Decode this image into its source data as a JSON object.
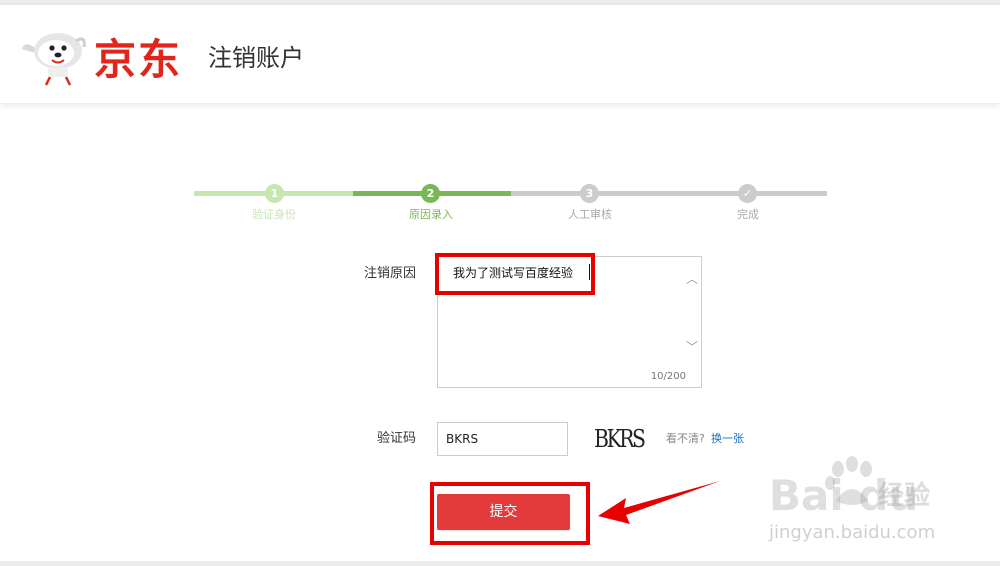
{
  "header": {
    "logo_text": "京东",
    "page_title": "注销账户"
  },
  "steps": [
    {
      "number": "1",
      "label": "验证身份",
      "state": "done"
    },
    {
      "number": "2",
      "label": "原因录入",
      "state": "current"
    },
    {
      "number": "3",
      "label": "人工审核",
      "state": "pending"
    },
    {
      "number": "✓",
      "label": "完成",
      "state": "pending"
    }
  ],
  "form": {
    "reason_label": "注销原因",
    "reason_value": "我为了测试写百度经验",
    "counter": "10/200",
    "code_label": "验证码",
    "code_value": "BKRS",
    "captcha_text": "BKRS",
    "unclear_text": "看不清?",
    "change_link": "换一张",
    "submit_label": "提交"
  },
  "watermark": {
    "brand": "Bai du",
    "jingyan": "经验",
    "url": "jingyan.baidu.com"
  },
  "colors": {
    "brand_red": "#e1251b",
    "step_done": "#c8e6b0",
    "step_active": "#7ab857",
    "step_pending": "#cccccc",
    "button": "#e33b3b",
    "highlight": "#e60000",
    "link": "#1a6fc1"
  },
  "icons": {
    "scroll_up": "chevron-up-icon",
    "scroll_down": "chevron-down-icon",
    "mascot": "jd-dog-icon",
    "arrow": "red-arrow-annotation",
    "paw": "baidu-paw-icon"
  }
}
